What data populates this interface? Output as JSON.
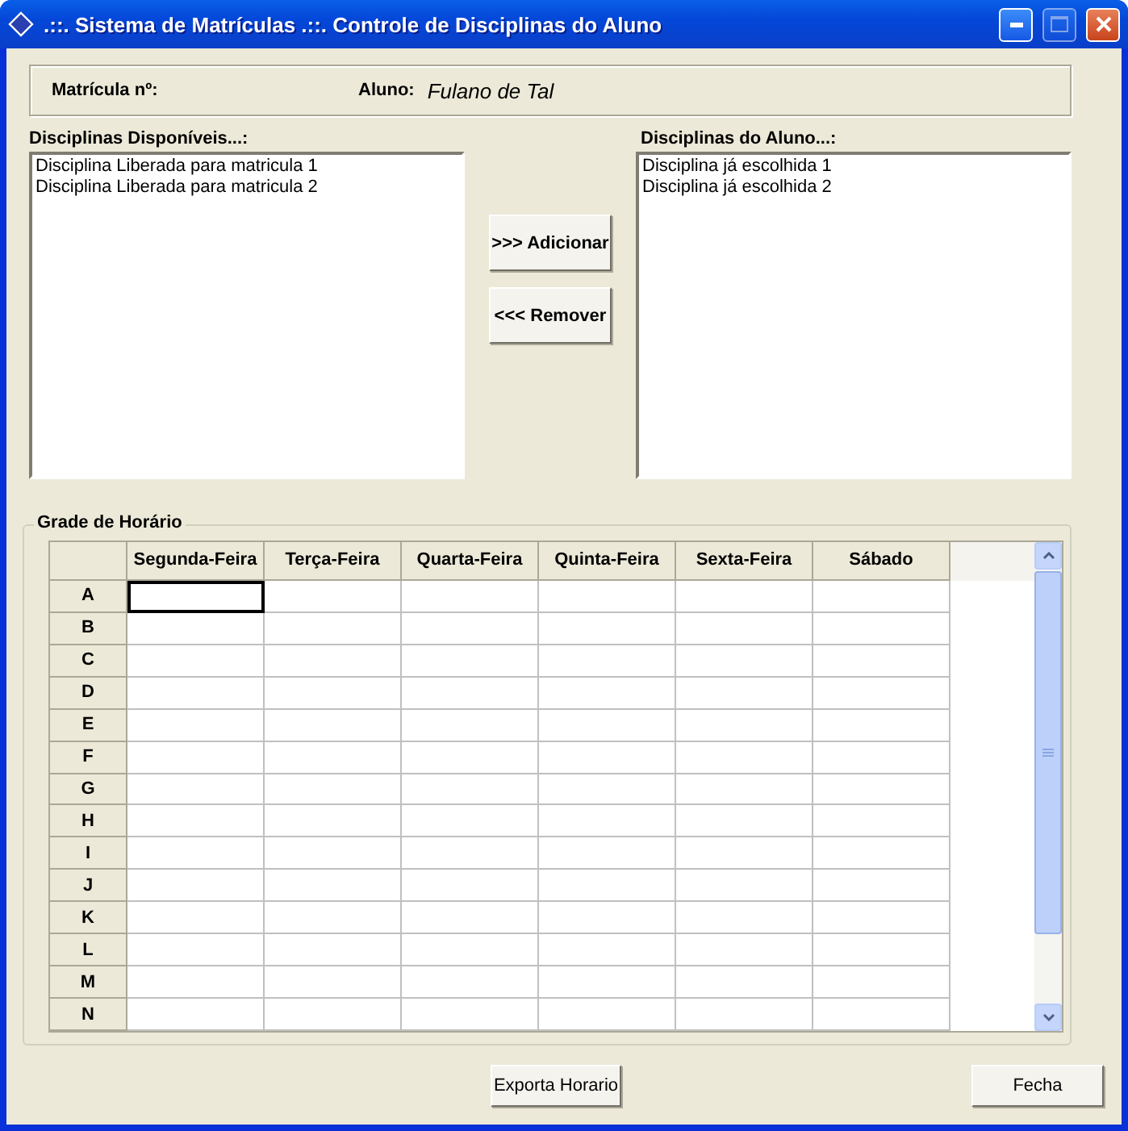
{
  "window": {
    "title": ".::. Sistema de Matrículas .::. Controle de Disciplinas do Aluno",
    "maximize_enabled": false
  },
  "info": {
    "matricula_label": "Matrícula nº:",
    "aluno_label": "Aluno:",
    "aluno_value": "Fulano de Tal"
  },
  "available": {
    "label": "Disciplinas Disponíveis...:",
    "items": [
      "Disciplina Liberada para matricula 1",
      "Disciplina Liberada para matricula 2"
    ]
  },
  "chosen": {
    "label": "Disciplinas do Aluno...:",
    "items": [
      "Disciplina já escolhida 1",
      "Disciplina já escolhida 2"
    ]
  },
  "move_buttons": [
    ">>> Adicionar",
    "<<< Remover"
  ],
  "schedule": {
    "title": "Grade de Horário",
    "columns": [
      "Segunda-Feira",
      "Terça-Feira",
      "Quarta-Feira",
      "Quinta-Feira",
      "Sexta-Feira",
      "Sábado"
    ],
    "rows": [
      {
        "header": "A",
        "cells": [
          {
            "selected": true
          },
          {
            "selected": false
          },
          {
            "selected": false
          },
          {
            "selected": false
          },
          {
            "selected": false
          },
          {
            "selected": false
          }
        ]
      },
      {
        "header": "B",
        "cells": [
          {
            "selected": false
          },
          {
            "selected": false
          },
          {
            "selected": false
          },
          {
            "selected": false
          },
          {
            "selected": false
          },
          {
            "selected": false
          }
        ]
      },
      {
        "header": "C",
        "cells": [
          {
            "selected": false
          },
          {
            "selected": false
          },
          {
            "selected": false
          },
          {
            "selected": false
          },
          {
            "selected": false
          },
          {
            "selected": false
          }
        ]
      },
      {
        "header": "D",
        "cells": [
          {
            "selected": false
          },
          {
            "selected": false
          },
          {
            "selected": false
          },
          {
            "selected": false
          },
          {
            "selected": false
          },
          {
            "selected": false
          }
        ]
      },
      {
        "header": "E",
        "cells": [
          {
            "selected": false
          },
          {
            "selected": false
          },
          {
            "selected": false
          },
          {
            "selected": false
          },
          {
            "selected": false
          },
          {
            "selected": false
          }
        ]
      },
      {
        "header": "F",
        "cells": [
          {
            "selected": false
          },
          {
            "selected": false
          },
          {
            "selected": false
          },
          {
            "selected": false
          },
          {
            "selected": false
          },
          {
            "selected": false
          }
        ]
      },
      {
        "header": "G",
        "cells": [
          {
            "selected": false
          },
          {
            "selected": false
          },
          {
            "selected": false
          },
          {
            "selected": false
          },
          {
            "selected": false
          },
          {
            "selected": false
          }
        ]
      },
      {
        "header": "H",
        "cells": [
          {
            "selected": false
          },
          {
            "selected": false
          },
          {
            "selected": false
          },
          {
            "selected": false
          },
          {
            "selected": false
          },
          {
            "selected": false
          }
        ]
      },
      {
        "header": "I",
        "cells": [
          {
            "selected": false
          },
          {
            "selected": false
          },
          {
            "selected": false
          },
          {
            "selected": false
          },
          {
            "selected": false
          },
          {
            "selected": false
          }
        ]
      },
      {
        "header": "J",
        "cells": [
          {
            "selected": false
          },
          {
            "selected": false
          },
          {
            "selected": false
          },
          {
            "selected": false
          },
          {
            "selected": false
          },
          {
            "selected": false
          }
        ]
      },
      {
        "header": "K",
        "cells": [
          {
            "selected": false
          },
          {
            "selected": false
          },
          {
            "selected": false
          },
          {
            "selected": false
          },
          {
            "selected": false
          },
          {
            "selected": false
          }
        ]
      },
      {
        "header": "L",
        "cells": [
          {
            "selected": false
          },
          {
            "selected": false
          },
          {
            "selected": false
          },
          {
            "selected": false
          },
          {
            "selected": false
          },
          {
            "selected": false
          }
        ]
      },
      {
        "header": "M",
        "cells": [
          {
            "selected": false
          },
          {
            "selected": false
          },
          {
            "selected": false
          },
          {
            "selected": false
          },
          {
            "selected": false
          },
          {
            "selected": false
          }
        ]
      },
      {
        "header": "N",
        "cells": [
          {
            "selected": false
          },
          {
            "selected": false
          },
          {
            "selected": false
          },
          {
            "selected": false
          },
          {
            "selected": false
          },
          {
            "selected": false
          }
        ]
      }
    ]
  },
  "bottom_buttons": [
    "Exporta Horario",
    "Fecha"
  ]
}
